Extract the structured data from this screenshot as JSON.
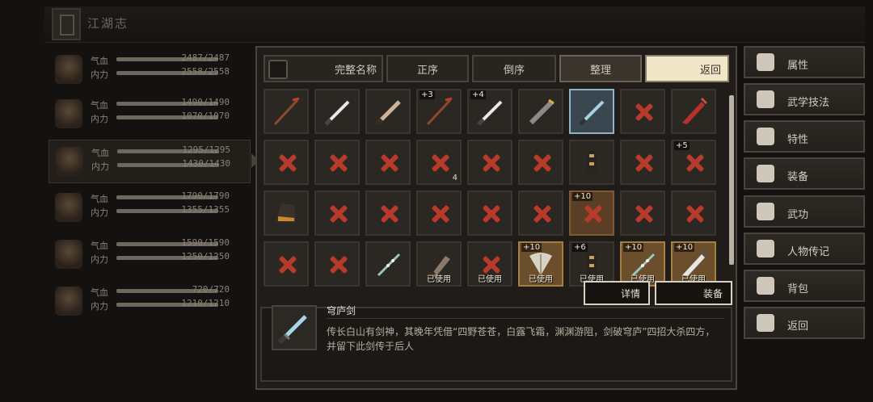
{
  "app": {
    "title": "江湖志"
  },
  "characters": [
    {
      "hp_label": "气血",
      "hp": "2487/2487",
      "mp_label": "内力",
      "mp": "2558/2558"
    },
    {
      "hp_label": "气血",
      "hp": "1490/1490",
      "mp_label": "内力",
      "mp": "1070/1070"
    },
    {
      "hp_label": "气血",
      "hp": "1295/1295",
      "mp_label": "内力",
      "mp": "1430/1430"
    },
    {
      "hp_label": "气血",
      "hp": "1790/1790",
      "mp_label": "内力",
      "mp": "1355/1355"
    },
    {
      "hp_label": "气血",
      "hp": "1590/1590",
      "mp_label": "内力",
      "mp": "1250/1250"
    },
    {
      "hp_label": "气血",
      "hp": "720/720",
      "mp_label": "内力",
      "mp": "1210/1210"
    }
  ],
  "toolbar": {
    "full_name": "完整名称",
    "asc": "正序",
    "desc": "倒序",
    "sort": "整理",
    "back": "返回"
  },
  "slots": [
    {
      "kind": "spear"
    },
    {
      "kind": "sword-white"
    },
    {
      "kind": "sword-tan"
    },
    {
      "kind": "spear",
      "level": "+3"
    },
    {
      "kind": "sword-white",
      "level": "+4"
    },
    {
      "kind": "sword-dark"
    },
    {
      "kind": "sword-blue",
      "state": "hl"
    },
    {
      "kind": "x"
    },
    {
      "kind": "blade-red"
    },
    {
      "kind": "x"
    },
    {
      "kind": "x"
    },
    {
      "kind": "x"
    },
    {
      "kind": "x",
      "count": "4"
    },
    {
      "kind": "x"
    },
    {
      "kind": "x"
    },
    {
      "kind": "claw"
    },
    {
      "kind": "x"
    },
    {
      "kind": "x",
      "level": "+5"
    },
    {
      "kind": "gauntlet"
    },
    {
      "kind": "x"
    },
    {
      "kind": "x"
    },
    {
      "kind": "x"
    },
    {
      "kind": "x"
    },
    {
      "kind": "x"
    },
    {
      "kind": "x",
      "level": "+10",
      "state": "tan"
    },
    {
      "kind": "x"
    },
    {
      "kind": "x"
    },
    {
      "kind": "x"
    },
    {
      "kind": "x"
    },
    {
      "kind": "flute"
    },
    {
      "kind": "dagger",
      "used": "已使用"
    },
    {
      "kind": "x",
      "used": "已使用"
    },
    {
      "kind": "fan",
      "level": "+10",
      "used": "已使用",
      "state": "used"
    },
    {
      "kind": "claw",
      "level": "+6",
      "used": "已使用"
    },
    {
      "kind": "flute",
      "level": "+10",
      "used": "已使用",
      "state": "used"
    },
    {
      "kind": "blade-white",
      "level": "+10",
      "used": "已使用",
      "state": "used"
    }
  ],
  "popup": {
    "detail": "详情",
    "equip": "装备"
  },
  "selected_item": {
    "name": "穹庐剑",
    "description": "传长白山有剑神，其晚年凭借“四野苍苍，白露飞霜，渊渊游阻，剑破穹庐”四招大杀四方，并留下此剑传于后人"
  },
  "side_menu": [
    {
      "label": "属性",
      "icon": "attributes-icon"
    },
    {
      "label": "武学技法",
      "icon": "martial-skills-icon"
    },
    {
      "label": "特性",
      "icon": "traits-icon"
    },
    {
      "label": "装备",
      "icon": "equipment-icon"
    },
    {
      "label": "武功",
      "icon": "kungfu-book-icon"
    },
    {
      "label": "人物传记",
      "icon": "biography-icon"
    },
    {
      "label": "背包",
      "icon": "backpack-icon"
    },
    {
      "label": "返回",
      "icon": "return-icon"
    }
  ]
}
